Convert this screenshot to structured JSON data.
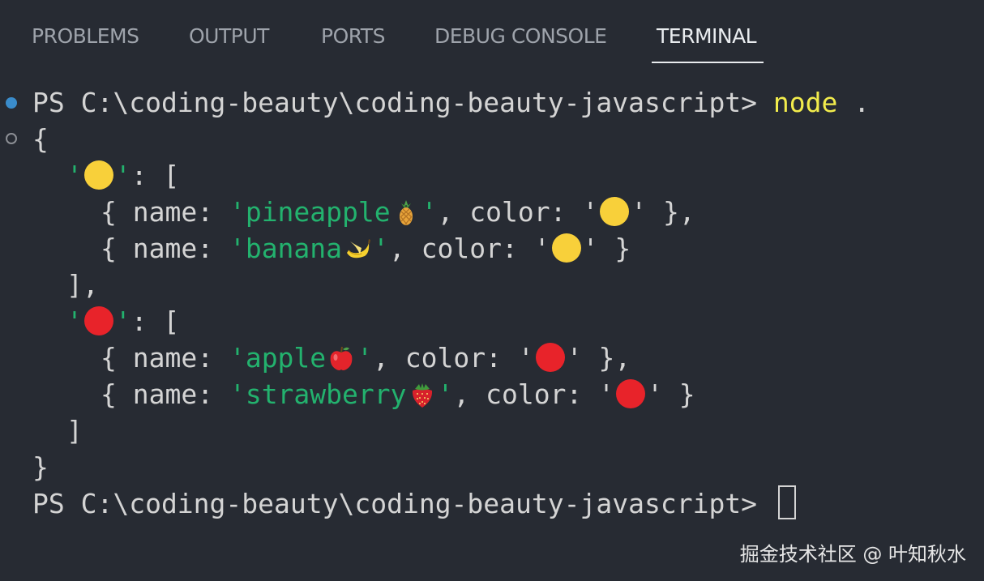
{
  "panel": {
    "tabs": [
      {
        "label": "PROBLEMS"
      },
      {
        "label": "OUTPUT"
      },
      {
        "label": "PORTS"
      },
      {
        "label": "DEBUG CONSOLE"
      },
      {
        "label": "TERMINAL",
        "active": true
      }
    ]
  },
  "terminal": {
    "prompt": "PS C:\\coding-beauty\\coding-beauty-javascript> ",
    "command": "node",
    "command_arg": " .",
    "open_brace": "{",
    "close_brace": "}",
    "groups": [
      {
        "key_emoji": "yellow-circle",
        "open": ": [",
        "close": "],",
        "items": [
          {
            "name_prefix": "{ name: ",
            "name_value": "'pineapple",
            "fruit_icon": "pineapple-icon",
            "after_name": "'",
            "color_label": ", color: '",
            "color_emoji": "yellow-circle",
            "end": "' },"
          },
          {
            "name_prefix": "{ name: ",
            "name_value": "'banana",
            "fruit_icon": "banana-icon",
            "after_name": "'",
            "color_label": ", color: '",
            "color_emoji": "yellow-circle",
            "end": "' }"
          }
        ]
      },
      {
        "key_emoji": "red-circle",
        "open": ": [",
        "close": "]",
        "items": [
          {
            "name_prefix": "{ name: ",
            "name_value": "'apple",
            "fruit_icon": "apple-icon",
            "after_name": "'",
            "color_label": ", color: '",
            "color_emoji": "red-circle",
            "end": "' },"
          },
          {
            "name_prefix": "{ name: ",
            "name_value": "'strawberry",
            "fruit_icon": "strawberry-icon",
            "after_name": "'",
            "color_label": ", color: '",
            "color_emoji": "red-circle",
            "end": "' }"
          }
        ]
      }
    ],
    "quote": "'"
  },
  "colors": {
    "background": "#272b33",
    "string": "#23b26e",
    "command": "#f2ec4c",
    "text": "#d4d4d4",
    "yellow_circle": "#f8d03a",
    "red_circle": "#e8232a",
    "decoration_active": "#3a8ccb"
  },
  "watermark": "掘金技术社区 @ 叶知秋水"
}
